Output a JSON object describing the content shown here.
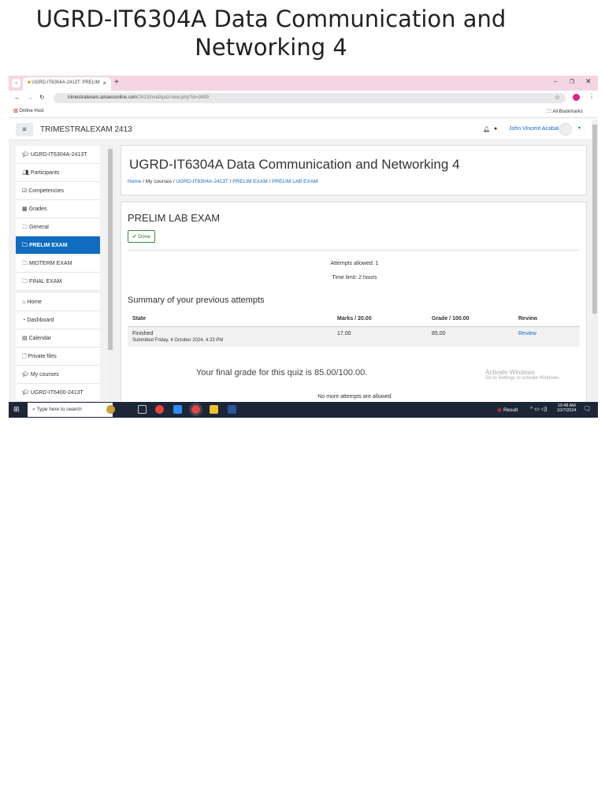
{
  "doc_title": "UGRD-IT6304A Data Communication and Networking 4",
  "browser": {
    "tab_title": "UGRD-IT6304A-2413T: PRELIM",
    "new_tab": "+",
    "url_host": "trimestralexam.amaesonline.com",
    "url_path": "/2413/mod/quiz/view.php?id=3459",
    "bookmark": "Online Host",
    "all_bookmarks": "All Bookmarks"
  },
  "header": {
    "site_name": "TRIMESTRALEXAM 2413",
    "user_name": "John Vincent Acabal"
  },
  "sidebar": {
    "items": [
      {
        "label": "UGRD-IT6304A-2413T",
        "icon": "graduation-cap"
      },
      {
        "label": "Participants",
        "icon": "users"
      },
      {
        "label": "Competencies",
        "icon": "check-square"
      },
      {
        "label": "Grades",
        "icon": "table"
      },
      {
        "label": "General",
        "icon": "folder"
      },
      {
        "label": "PRELIM EXAM",
        "icon": "folder",
        "active": true
      },
      {
        "label": "MIDTERM EXAM",
        "icon": "folder"
      },
      {
        "label": "FINAL EXAM",
        "icon": "folder"
      }
    ],
    "items2": [
      {
        "label": "Home",
        "icon": "home"
      },
      {
        "label": "Dashboard",
        "icon": "dashboard"
      },
      {
        "label": "Calendar",
        "icon": "calendar"
      },
      {
        "label": "Private files",
        "icon": "file"
      },
      {
        "label": "My courses",
        "icon": "graduation-cap"
      },
      {
        "label": "UGRD-IT6400-2413T",
        "icon": "graduation-cap"
      }
    ]
  },
  "course": {
    "title": "UGRD-IT6304A Data Communication and Networking 4",
    "breadcrumb": [
      "Home",
      "My courses",
      "UGRD-IT6304A-2413T",
      "PRELIM EXAM",
      "PRELIM LAB EXAM"
    ]
  },
  "quiz": {
    "title": "PRELIM LAB EXAM",
    "done": "Done",
    "attempts_allowed": "Attempts allowed: 1",
    "time_limit": "Time limit: 2 hours",
    "summary_heading": "Summary of your previous attempts",
    "columns": [
      "State",
      "Marks / 20.00",
      "Grade / 100.00",
      "Review"
    ],
    "rows": [
      {
        "state": "Finished",
        "submitted": "Submitted Friday, 4 October 2024, 4:23 PM",
        "marks": "17.00",
        "grade": "85.00",
        "review": "Review"
      }
    ],
    "final_grade": "Your final grade for this quiz is 85.00/100.00.",
    "no_more": "No more attempts are allowed"
  },
  "watermark": {
    "line1": "Activate Windows",
    "line2": "Go to Settings to activate Windows."
  },
  "taskbar": {
    "search_placeholder": "Type here to search",
    "result": "Result",
    "time": "10:48 AM",
    "date": "10/7/2024"
  }
}
